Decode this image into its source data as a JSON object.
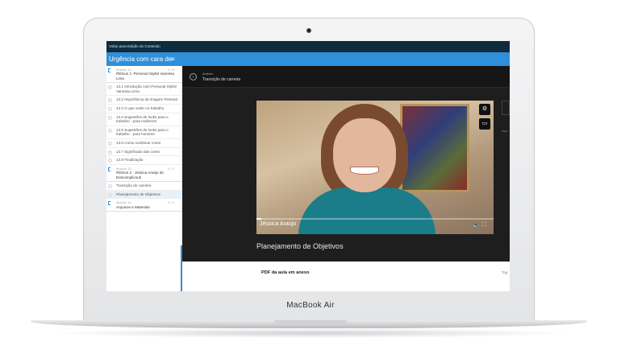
{
  "device": {
    "brand_label": "MacBook Air"
  },
  "app": {
    "top_link": "Voltar para Edição do Conteúdo",
    "course_title": "Urgência com cara de",
    "menu_icon": "hamburger-icon"
  },
  "sidebar": {
    "module14": {
      "label": "Módulo 14",
      "count": "0 / 8",
      "title": "#bônus 1: Personal Stylist Vanessa Lima"
    },
    "items14": [
      "13.1 Introdução com Personal Stylist Vanessa Lima",
      "13.2 Importância da imagem Pessoal",
      "13.3 O que vestir no trabalho",
      "13.4 Sugestões de looks para o trabalho - para mulheres",
      "13.5 Sugestões de looks para o trabalho - para homens",
      "13.6 Como combinar cores",
      "13.7 Significado das cores",
      "13.8 Finalização"
    ],
    "module15": {
      "label": "Módulo 15",
      "count": "0 / 2",
      "title": "#bônus 2 - Jéssica Araújo do Descomplicouti"
    },
    "items15": [
      "Transição de carreira",
      "Planejamento de Objetivos"
    ],
    "module16": {
      "label": "Módulo 16",
      "count": "0 / 4",
      "title": "Arquivos e Materiais"
    }
  },
  "lesson": {
    "prev_label": "Anterior",
    "prev_title": "Transição de carreira",
    "title": "Planejamento de Objetivos",
    "video_caption": "Jéssica Araújo",
    "video_progress": 0.02,
    "side_text": "Ava",
    "attachment_title": "PDF da aula em anexo",
    "attachment_tag": "Tag"
  },
  "colors": {
    "accent": "#2f8fd8",
    "topbar": "#0f2c3e",
    "video_bg": "#1e1e1e"
  }
}
